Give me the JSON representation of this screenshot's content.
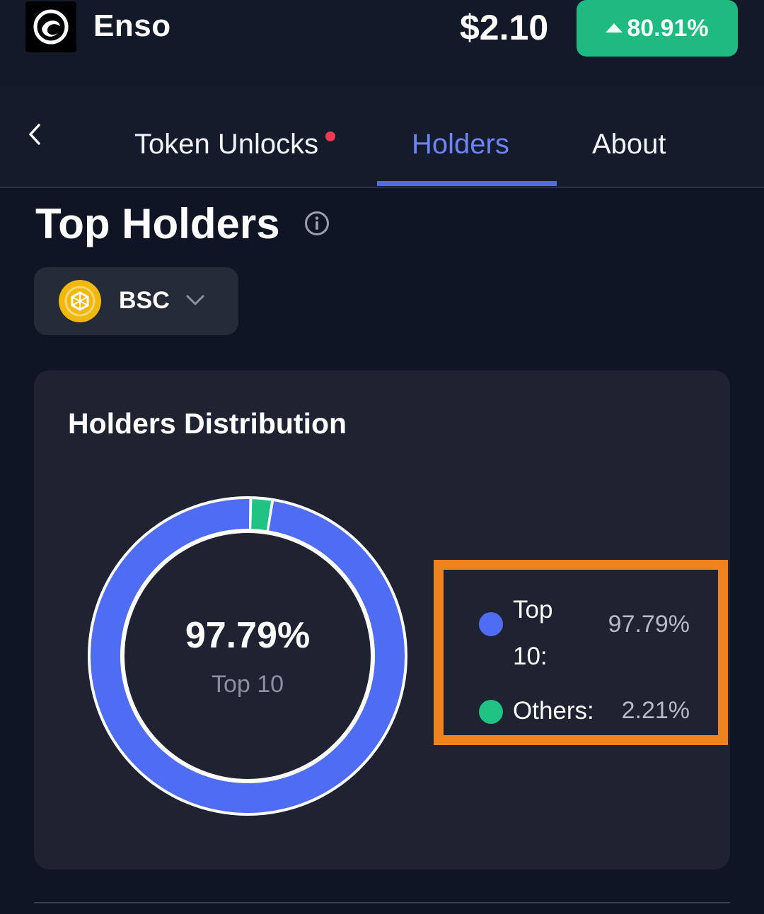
{
  "header": {
    "app_name": "Enso",
    "logo_icon": "enso-logo-icon",
    "price": "$2.10",
    "change": "80.91%",
    "change_direction": "up",
    "change_color": "#1fba80"
  },
  "tabs": {
    "items": [
      {
        "label": "Token Unlocks",
        "has_notification_dot": true
      },
      {
        "label": "Holders",
        "active": true
      },
      {
        "label": "About"
      }
    ],
    "active_color": "#6e84f5"
  },
  "section": {
    "title": "Top Holders",
    "info_icon": "info-icon"
  },
  "chain_select": {
    "selected": "BSC",
    "icon": "bnb-chain-icon"
  },
  "card": {
    "title": "Holders Distribution",
    "center_value": "97.79%",
    "center_label": "Top 10"
  },
  "chart_data": {
    "type": "pie",
    "categories": [
      "Top 10:",
      "Others:"
    ],
    "values": [
      97.79,
      2.21
    ],
    "value_labels": [
      "97.79%",
      "2.21%"
    ],
    "colors": [
      "#4e6df3",
      "#1fc383"
    ],
    "legend_position": "right"
  }
}
